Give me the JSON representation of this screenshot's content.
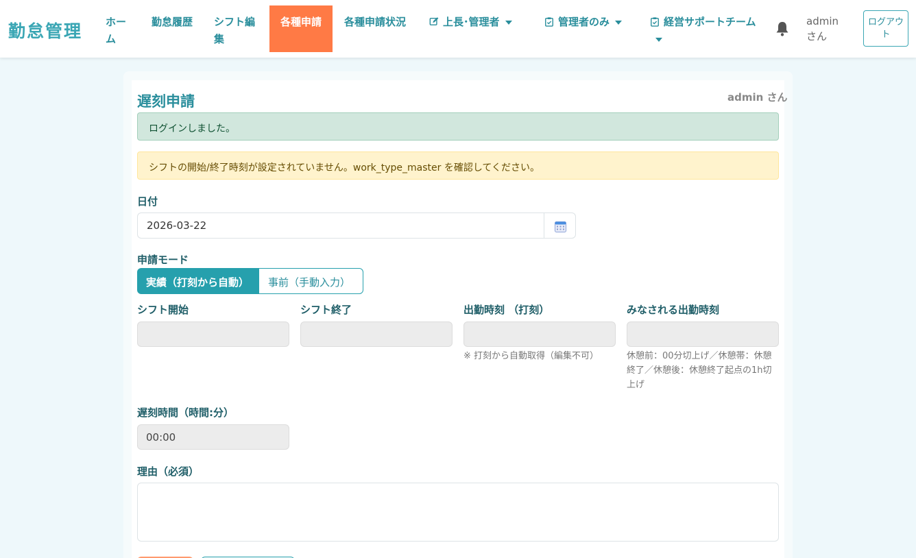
{
  "nav": {
    "brand": "勤怠管理",
    "items": [
      {
        "label": "ホーム"
      },
      {
        "label": "勤怠履歴"
      },
      {
        "label": "シフト編集"
      },
      {
        "label": "各種申請"
      },
      {
        "label": "各種申請状況"
      },
      {
        "label": "上長･管理者"
      },
      {
        "label": "管理者のみ"
      },
      {
        "label": "経営サポートチーム"
      }
    ],
    "user": "admin さん",
    "logout": "ログアウト"
  },
  "page": {
    "title": "遅刻申請",
    "user": "admin さん",
    "alert_success": "ログインしました。",
    "alert_warning": "シフトの開始/終了時刻が設定されていません。work_type_master を確認してください。"
  },
  "form": {
    "date_label": "日付",
    "date_value": "2026-03-22",
    "mode_label": "申請モード",
    "mode_actual": "実績（打刻から自動）",
    "mode_advance": "事前（手動入力）",
    "shift_start_label": "シフト開始",
    "shift_end_label": "シフト終了",
    "clock_in_label": "出勤時刻 （打刻）",
    "clock_in_help": "※ 打刻から自動取得（編集不可）",
    "deemed_label": "みなされる出勤時刻",
    "deemed_help": "休憩前：00分切上げ／休憩帯：休憩終了／休憩後：休憩終了起点の1h切上げ",
    "late_label": "遅刻時間（時間:分）",
    "late_value": "00:00",
    "reason_label": "理由（必須）"
  },
  "colors": {
    "accent": "#26a0ad",
    "active_tab": "#ff7a45"
  }
}
